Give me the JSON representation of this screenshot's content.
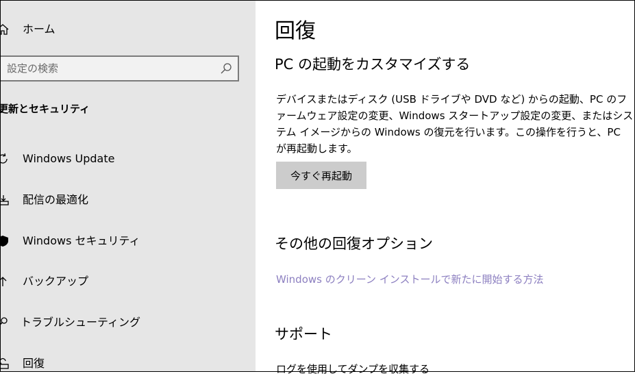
{
  "sidebar": {
    "home_label": "ホーム",
    "search": {
      "placeholder": "設定の検索"
    },
    "section_heading": "更新とセキュリティ",
    "items": [
      {
        "label": "Windows Update",
        "icon": "refresh-icon"
      },
      {
        "label": "配信の最適化",
        "icon": "delivery-optimization-icon"
      },
      {
        "label": "Windows セキュリティ",
        "icon": "shield-icon"
      },
      {
        "label": "バックアップ",
        "icon": "backup-arrow-icon"
      },
      {
        "label": "トラブルシューティング",
        "icon": "wrench-icon"
      },
      {
        "label": "回復",
        "icon": "recovery-icon"
      }
    ]
  },
  "main": {
    "title": "回復",
    "customize_heading": "PC の起動をカスタマイズする",
    "customize_description": "デバイスまたはディスク (USB ドライブや DVD など) からの起動、PC のファームウェア設定の変更、Windows スタートアップ設定の変更、またはシステム イメージからの Windows の復元を行います。この操作を行うと、PC が再起動します。",
    "restart_button_label": "今すぐ再起動",
    "more_options_heading": "その他の回復オプション",
    "clean_install_link": "Windows のクリーン インストールで新たに開始する方法",
    "support_heading": "サポート",
    "support_text": "ログを使用してダンプを収集する"
  },
  "colors": {
    "sidebar_bg": "#e6e6e6",
    "link": "#8c7fc0",
    "button_bg": "#cccccc"
  }
}
